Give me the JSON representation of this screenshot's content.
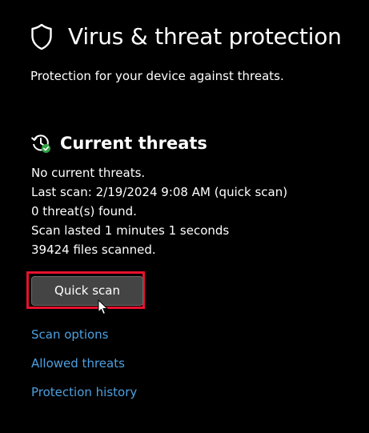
{
  "header": {
    "title": "Virus & threat protection",
    "subtitle": "Protection for your device against threats.",
    "icon": "shield-icon"
  },
  "current_threats": {
    "title": "Current threats",
    "icon": "history-check-icon",
    "lines": [
      "No current threats.",
      "Last scan: 2/19/2024 9:08 AM (quick scan)",
      "0 threat(s) found.",
      "Scan lasted 1 minutes 1 seconds",
      "39424 files scanned."
    ],
    "quick_scan_label": "Quick scan"
  },
  "links": {
    "scan_options": "Scan options",
    "allowed_threats": "Allowed threats",
    "protection_history": "Protection history"
  },
  "colors": {
    "background": "#000000",
    "text": "#ffffff",
    "link": "#4ca0e0",
    "button": "#444444",
    "highlight": "#e8112d",
    "status_ok": "#2ea043"
  }
}
